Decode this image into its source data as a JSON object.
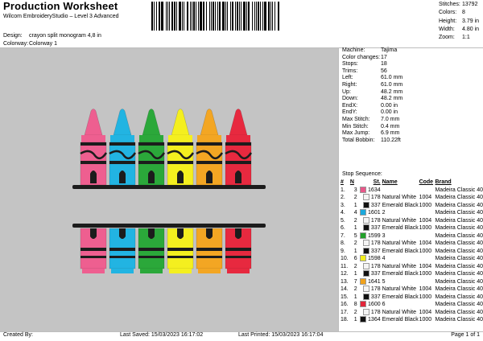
{
  "header": {
    "title": "Production Worksheet",
    "subtitle": "Wilcom EmbroideryStudio – Level 3 Advanced"
  },
  "stats": [
    {
      "label": "Stitches:",
      "value": "13792"
    },
    {
      "label": "Colors:",
      "value": "8"
    },
    {
      "label": "Height:",
      "value": "3.79 in"
    },
    {
      "label": "Width:",
      "value": "4.80 in"
    },
    {
      "label": "Zoom:",
      "value": "1:1"
    }
  ],
  "design": {
    "design_label": "Design:",
    "design_value": "crayon split monogram 4,8 in",
    "colorway_label": "Colorway:",
    "colorway_value": "Colorway 1"
  },
  "info": [
    {
      "label": "Machine:",
      "value": "Tajima"
    },
    {
      "label": "Color changes:",
      "value": "17"
    },
    {
      "label": "Stops:",
      "value": "18"
    },
    {
      "label": "Trims:",
      "value": "56"
    },
    {
      "label": "Left:",
      "value": "61.0 mm"
    },
    {
      "label": "Right:",
      "value": "61.0 mm"
    },
    {
      "label": "Up:",
      "value": "48.2 mm"
    },
    {
      "label": "Down:",
      "value": "48.2 mm"
    },
    {
      "label": "EndX:",
      "value": "0.00 in"
    },
    {
      "label": "EndY:",
      "value": "0.00 in"
    },
    {
      "label": "Max Stitch:",
      "value": "7.0 mm"
    },
    {
      "label": "Min Stitch:",
      "value": "0.4 mm"
    },
    {
      "label": "Max Jump:",
      "value": "6.9 mm"
    },
    {
      "label": "Total Bobbin:",
      "value": "110.22ft"
    }
  ],
  "stop_sequence": {
    "title": "Stop Sequence:",
    "headers": [
      "#",
      "N",
      "St.",
      "Name",
      "Code",
      "Brand"
    ],
    "rows": [
      {
        "num": "1.",
        "n": "3",
        "color": "#e8578a",
        "st": "1634",
        "name": "",
        "code": "",
        "brand": "Madeira Classic 40"
      },
      {
        "num": "2.",
        "n": "2",
        "color": "#f4f4f4",
        "st": "178",
        "name": "Natural White",
        "code": "1004",
        "brand": "Madeira Classic 40"
      },
      {
        "num": "3.",
        "n": "1",
        "color": "#111111",
        "st": "337",
        "name": "Emerald Black",
        "code": "1000",
        "brand": "Madeira Classic 40"
      },
      {
        "num": "4.",
        "n": "4",
        "color": "#1aa8dc",
        "st": "1601",
        "name": "2",
        "code": "",
        "brand": "Madeira Classic 40"
      },
      {
        "num": "5.",
        "n": "2",
        "color": "#f4f4f4",
        "st": "178",
        "name": "Natural White",
        "code": "1004",
        "brand": "Madeira Classic 40"
      },
      {
        "num": "6.",
        "n": "1",
        "color": "#111111",
        "st": "337",
        "name": "Emerald Black",
        "code": "1000",
        "brand": "Madeira Classic 40"
      },
      {
        "num": "7.",
        "n": "5",
        "color": "#22a12a",
        "st": "1599",
        "name": "3",
        "code": "",
        "brand": "Madeira Classic 40"
      },
      {
        "num": "8.",
        "n": "2",
        "color": "#f4f4f4",
        "st": "178",
        "name": "Natural White",
        "code": "1004",
        "brand": "Madeira Classic 40"
      },
      {
        "num": "9.",
        "n": "1",
        "color": "#111111",
        "st": "337",
        "name": "Emerald Black",
        "code": "1000",
        "brand": "Madeira Classic 40"
      },
      {
        "num": "10.",
        "n": "6",
        "color": "#f2ee1e",
        "st": "1598",
        "name": "4",
        "code": "",
        "brand": "Madeira Classic 40"
      },
      {
        "num": "11.",
        "n": "2",
        "color": "#f4f4f4",
        "st": "178",
        "name": "Natural White",
        "code": "1004",
        "brand": "Madeira Classic 40"
      },
      {
        "num": "12.",
        "n": "1",
        "color": "#111111",
        "st": "337",
        "name": "Emerald Black",
        "code": "1000",
        "brand": "Madeira Classic 40"
      },
      {
        "num": "13.",
        "n": "7",
        "color": "#f0a21c",
        "st": "1641",
        "name": "5",
        "code": "",
        "brand": "Madeira Classic 40"
      },
      {
        "num": "14.",
        "n": "2",
        "color": "#f4f4f4",
        "st": "178",
        "name": "Natural White",
        "code": "1004",
        "brand": "Madeira Classic 40"
      },
      {
        "num": "15.",
        "n": "1",
        "color": "#111111",
        "st": "337",
        "name": "Emerald Black",
        "code": "1000",
        "brand": "Madeira Classic 40"
      },
      {
        "num": "16.",
        "n": "8",
        "color": "#e2253a",
        "st": "1600",
        "name": "6",
        "code": "",
        "brand": "Madeira Classic 40"
      },
      {
        "num": "17.",
        "n": "2",
        "color": "#f4f4f4",
        "st": "178",
        "name": "Natural White",
        "code": "1004",
        "brand": "Madeira Classic 40"
      },
      {
        "num": "18.",
        "n": "1",
        "color": "#111111",
        "st": "1364",
        "name": "Emerald Black",
        "code": "1000",
        "brand": "Madeira Classic 40"
      }
    ]
  },
  "design_preview": {
    "crayon_colors": [
      "#ee5f90",
      "#22b4e2",
      "#2ba83a",
      "#f4ef1f",
      "#f3a623",
      "#e7293f"
    ],
    "outline_color": "#1c1c1c",
    "background": "#c4c4c4"
  },
  "footer": {
    "created_by": "Created By:",
    "last_saved": "Last Saved: 15/03/2023 16:17:02",
    "last_printed": "Last Printed: 15/03/2023 16:17:04",
    "page": "Page 1 of 1"
  }
}
